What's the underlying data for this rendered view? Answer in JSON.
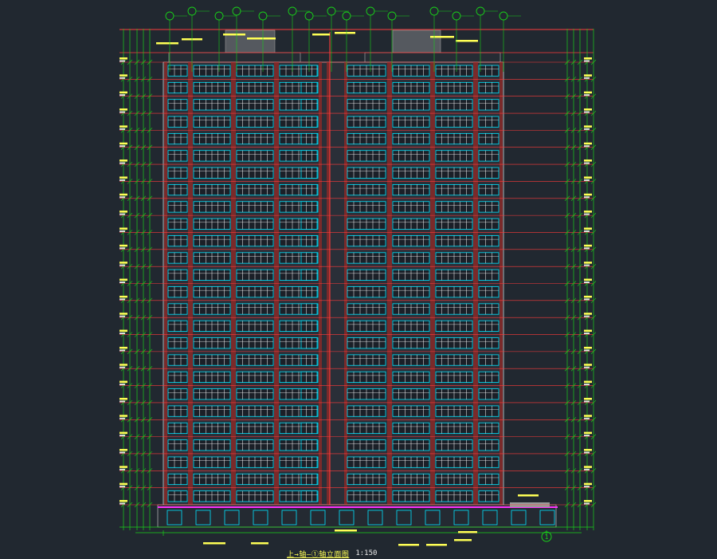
{
  "drawing": {
    "title": "上→轴—①轴立面图",
    "scale": "1:150",
    "floors_shown": 26,
    "bottom_axis_label": "1"
  },
  "colors": {
    "background": "#212830",
    "window_frame": "#00e5ff",
    "glazing": "#ffffff",
    "wall": "#7a2a2a",
    "facade_line": "#ff3b3b",
    "dimension_line": "#19d119",
    "grid_bubble": "#19d119",
    "annotation": "#ffff55",
    "podium_line": "#ff33ff"
  }
}
